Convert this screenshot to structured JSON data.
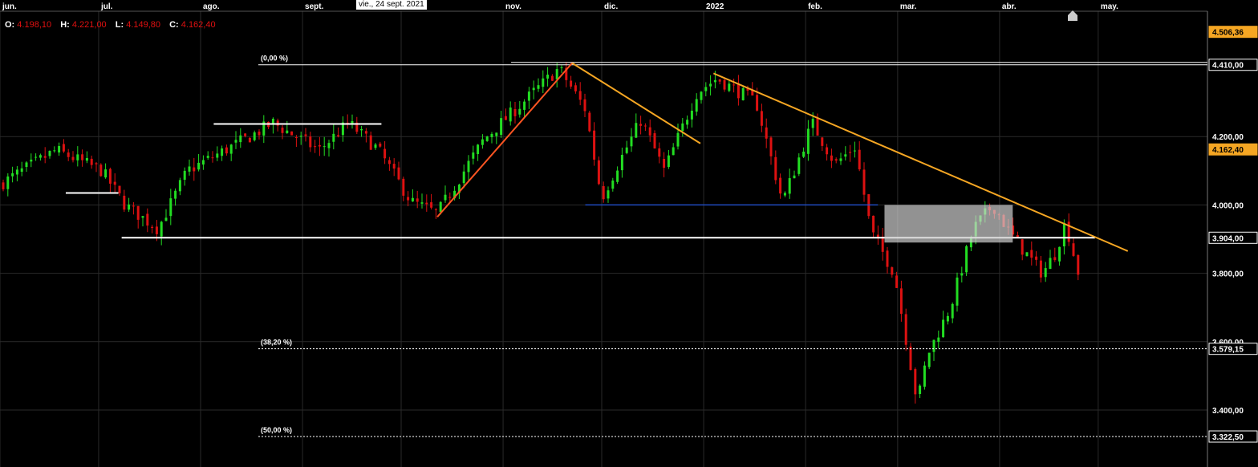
{
  "ohlc": {
    "open_label": "O:",
    "open": "4.198,10",
    "high_label": "H:",
    "high": "4.221,00",
    "low_label": "L:",
    "low": "4.149,80",
    "close_label": "C:",
    "close": "4.162,40"
  },
  "tooltip": "vie., 24 sept. 2021",
  "colors": {
    "background": "#000000",
    "up": "#22dd22",
    "down": "#dd1111",
    "trendline": "#f5a623",
    "support": "#ffffff",
    "blue_line": "#2255dd",
    "price_badge": "#f5a623"
  },
  "icons": [
    "home-icon"
  ],
  "chart_data": {
    "type": "candlestick",
    "x_labels": [
      "jun.",
      "jul.",
      "ago.",
      "sept.",
      "nov.",
      "dic.",
      "2022",
      "feb.",
      "mar.",
      "abr.",
      "may."
    ],
    "y_ticks": [
      "4.200,00",
      "4.000,00",
      "3.800,00",
      "3.600,00",
      "3.400,00"
    ],
    "ylim": [
      3300,
      4575
    ],
    "grid": true,
    "price_badges": [
      {
        "label": "4.506,36",
        "value": 4506.36,
        "style": "orange"
      },
      {
        "label": "4.410,00",
        "value": 4410.0,
        "style": "white"
      },
      {
        "label": "4.162,40",
        "value": 4162.4,
        "style": "orange"
      },
      {
        "label": "3.904,00",
        "value": 3904.0,
        "style": "white"
      },
      {
        "label": "3.579,15",
        "value": 3579.15,
        "style": "white"
      },
      {
        "label": "3.322,50",
        "value": 3322.5,
        "style": "white"
      }
    ],
    "fibonacci": [
      {
        "label": "(0,00 %)",
        "value": 4410.0
      },
      {
        "label": "(38,20 %)",
        "value": 3579.15
      },
      {
        "label": "(50,00 %)",
        "value": 3322.5
      }
    ],
    "waypoints": [
      {
        "date": "2021-06-01",
        "price": 4060
      },
      {
        "date": "2021-06-18",
        "price": 4160
      },
      {
        "date": "2021-07-02",
        "price": 4100
      },
      {
        "date": "2021-07-09",
        "price": 4000
      },
      {
        "date": "2021-07-19",
        "price": 3930
      },
      {
        "date": "2021-07-28",
        "price": 4100
      },
      {
        "date": "2021-08-16",
        "price": 4200
      },
      {
        "date": "2021-08-23",
        "price": 4240
      },
      {
        "date": "2021-09-06",
        "price": 4160
      },
      {
        "date": "2021-09-15",
        "price": 4240
      },
      {
        "date": "2021-09-24",
        "price": 4162
      },
      {
        "date": "2021-10-04",
        "price": 4010
      },
      {
        "date": "2021-10-12",
        "price": 3975
      },
      {
        "date": "2021-10-26",
        "price": 4190
      },
      {
        "date": "2021-11-18",
        "price": 4400
      },
      {
        "date": "2021-11-26",
        "price": 4280
      },
      {
        "date": "2021-12-01",
        "price": 4020
      },
      {
        "date": "2021-12-06",
        "price": 4120
      },
      {
        "date": "2021-12-13",
        "price": 4250
      },
      {
        "date": "2021-12-20",
        "price": 4100
      },
      {
        "date": "2021-12-30",
        "price": 4330
      },
      {
        "date": "2022-01-05",
        "price": 4370
      },
      {
        "date": "2022-01-17",
        "price": 4300
      },
      {
        "date": "2022-01-25",
        "price": 4010
      },
      {
        "date": "2022-02-03",
        "price": 4240
      },
      {
        "date": "2022-02-10",
        "price": 4120
      },
      {
        "date": "2022-02-16",
        "price": 4170
      },
      {
        "date": "2022-02-21",
        "price": 3920
      },
      {
        "date": "2022-02-28",
        "price": 3800
      },
      {
        "date": "2022-03-07",
        "price": 3420
      },
      {
        "date": "2022-03-10",
        "price": 3560
      },
      {
        "date": "2022-03-17",
        "price": 3700
      },
      {
        "date": "2022-03-24",
        "price": 3930
      },
      {
        "date": "2022-03-30",
        "price": 4000
      },
      {
        "date": "2022-04-04",
        "price": 3920
      },
      {
        "date": "2022-04-08",
        "price": 3870
      },
      {
        "date": "2022-04-14",
        "price": 3800
      },
      {
        "date": "2022-04-18",
        "price": 3860
      },
      {
        "date": "2022-04-21",
        "price": 3950
      },
      {
        "date": "2022-04-25",
        "price": 3800
      }
    ],
    "trendlines": [
      {
        "from": {
          "date": "2021-10-12",
          "price": 3965
        },
        "to": {
          "date": "2021-11-22",
          "price": 4415
        },
        "color": "orange-red"
      },
      {
        "from": {
          "date": "2021-11-22",
          "price": 4415
        },
        "to": {
          "date": "2021-12-31",
          "price": 4180
        },
        "color": "orange"
      },
      {
        "from": {
          "date": "2022-01-04",
          "price": 4385
        },
        "to": {
          "date": "2022-05-10",
          "price": 3865
        },
        "color": "orange"
      }
    ],
    "horizontal_lines": [
      {
        "from": "2021-06-21",
        "to": "2021-07-07",
        "price": 4035,
        "color": "white"
      },
      {
        "from": "2021-07-08",
        "to": "2022-04-30",
        "price": 3904,
        "color": "white"
      },
      {
        "from": "2021-08-05",
        "to": "2021-09-25",
        "price": 4237,
        "color": "white"
      },
      {
        "from": "2021-11-26",
        "to": "2022-02-23",
        "price": 4000,
        "color": "blue"
      }
    ],
    "rectangle": {
      "from": "2022-02-25",
      "to": "2022-04-05",
      "price_top": 4000,
      "price_bottom": 3890
    }
  }
}
